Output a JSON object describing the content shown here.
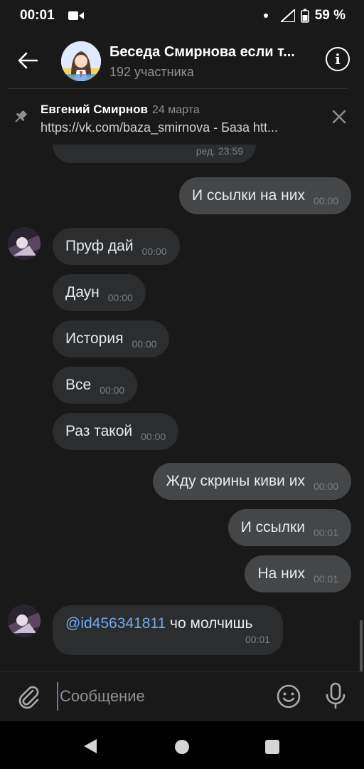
{
  "status_bar": {
    "time": "00:01",
    "battery": "59 %"
  },
  "header": {
    "title": "Беседа Смирнова  если т...",
    "subtitle": "192 участника"
  },
  "pinned": {
    "author": "Евгений Смирнов",
    "date": "24 марта",
    "text": "https://vk.com/baza_smirnova - База htt..."
  },
  "messages": {
    "partial_edited": "ред. 23:59",
    "items": [
      {
        "dir": "out",
        "text": "И ссылки на них",
        "time": "00:00"
      },
      {
        "dir": "in",
        "text": "Пруф дай",
        "time": "00:00"
      },
      {
        "dir": "in",
        "text": "Даун",
        "time": "00:00"
      },
      {
        "dir": "in",
        "text": "История",
        "time": "00:00"
      },
      {
        "dir": "in",
        "text": "Все",
        "time": "00:00"
      },
      {
        "dir": "in",
        "text": "Раз такой",
        "time": "00:00"
      },
      {
        "dir": "out",
        "text": "Жду скрины киви их",
        "time": "00:00"
      },
      {
        "dir": "out",
        "text": "И ссылки",
        "time": "00:01"
      },
      {
        "dir": "out",
        "text": "На них",
        "time": "00:01"
      },
      {
        "dir": "in",
        "mention": "@id456341811",
        "text": " чо молчишь",
        "time": "00:01"
      }
    ]
  },
  "composer": {
    "placeholder": "Сообщение"
  },
  "colors": {
    "background": "#19191a",
    "incoming": "#2c2d2e",
    "outgoing": "#454647",
    "link": "#71aaeb"
  },
  "icons": [
    "video-icon",
    "wifi-icon",
    "battery-icon",
    "back-arrow-icon",
    "info-icon",
    "pin-icon",
    "close-icon",
    "attach-icon",
    "emoji-icon",
    "mic-icon",
    "nav-back-icon",
    "nav-home-icon",
    "nav-recent-icon"
  ]
}
